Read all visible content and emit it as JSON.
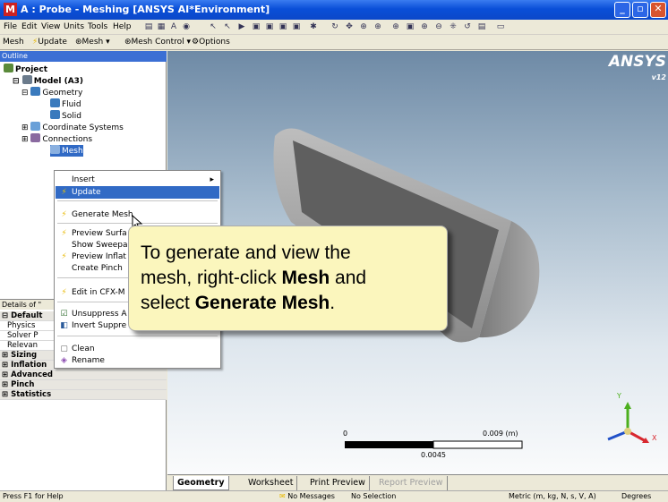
{
  "window": {
    "title": "A : Probe - Meshing [ANSYS AI*Environment]",
    "app_icon": "M"
  },
  "menubar": [
    "File",
    "Edit",
    "View",
    "Units",
    "Tools",
    "Help"
  ],
  "toolbar2": {
    "mesh": "Mesh",
    "update": "Update",
    "mesh_dropdown": "Mesh ▾",
    "mesh_control": "Mesh Control ▾",
    "options": "Options"
  },
  "outline": {
    "header": "Outline",
    "items": [
      "Project",
      "Model (A3)",
      "Geometry",
      "Fluid",
      "Solid",
      "Coordinate Systems",
      "Connections",
      "Mesh"
    ]
  },
  "context_menu": {
    "items": [
      "Insert",
      "Update",
      "Generate Mesh",
      "Preview Surfa",
      "Show Sweepa",
      "Preview Inflat",
      "Create Pinch",
      "Edit in CFX-M",
      "Unsuppress A",
      "Invert Suppre",
      "Clean",
      "Rename"
    ]
  },
  "details": {
    "header": "Details of \"",
    "rows": [
      "Default",
      "Physics",
      "Solver P",
      "Relevan",
      "Sizing",
      "Inflation",
      "Advanced",
      "Pinch",
      "Statistics"
    ]
  },
  "viewport": {
    "logo": "ANSYS",
    "version": "v12",
    "scale": {
      "zero": "0",
      "max": "0.009 (m)",
      "mid": "0.0045"
    },
    "triad": {
      "x": "X",
      "y": "Y"
    }
  },
  "callout": {
    "line1": "To generate and view the",
    "line2_prefix": "mesh, right-click ",
    "line2_bold": "Mesh",
    "line2_suffix": " and",
    "line3_prefix": "select ",
    "line3_bold": "Generate Mesh",
    "line3_suffix": "."
  },
  "tabs": [
    "Geometry",
    "Worksheet",
    "Print Preview",
    "Report Preview"
  ],
  "statusbar": {
    "help": "Press F1 for Help",
    "messages": "No Messages",
    "selection": "No Selection",
    "units": "Metric (m, kg, N, s, V, A)",
    "angle": "Degrees"
  },
  "colors": {
    "titlebar": "#0a4fd8",
    "highlight": "#316ac5",
    "callout_bg": "#fbf6bd",
    "body_fill": "#5f5f5f"
  }
}
